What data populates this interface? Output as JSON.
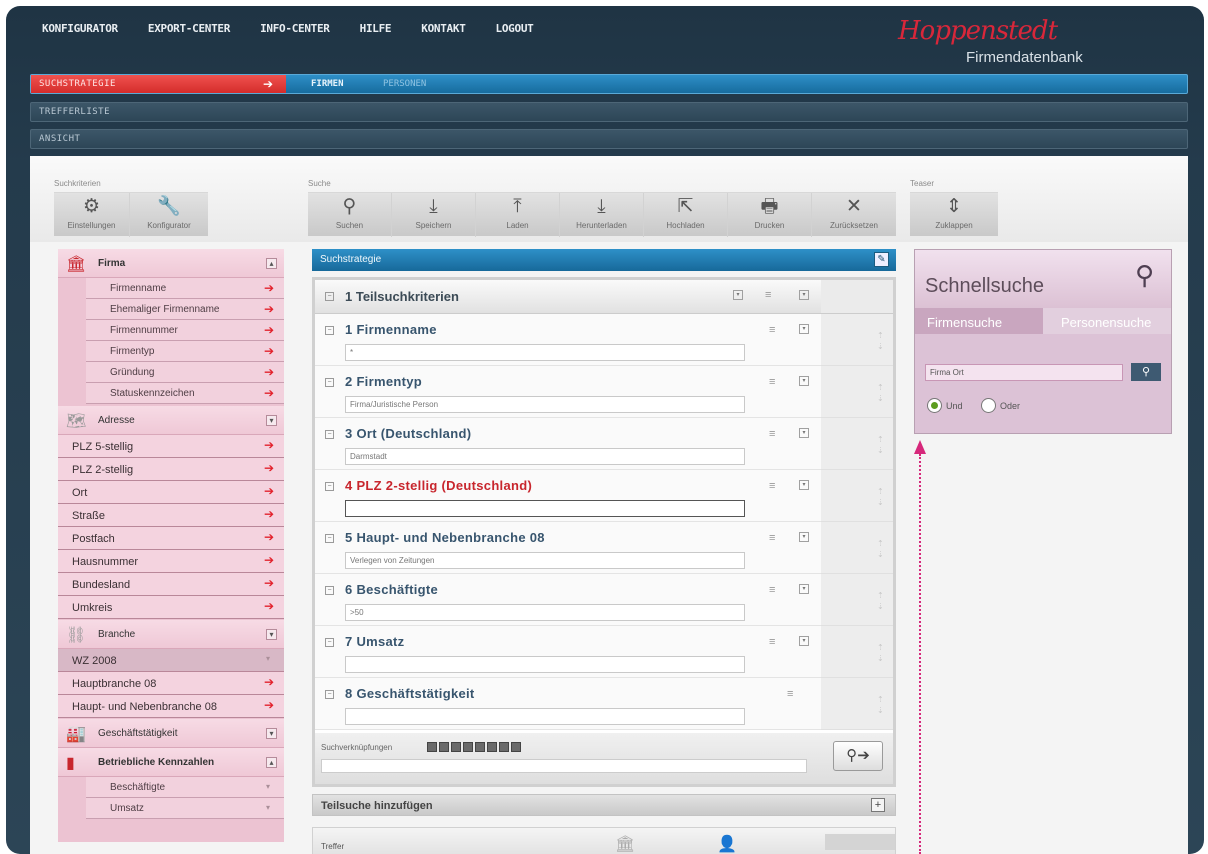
{
  "topnav": [
    "KONFIGURATOR",
    "EXPORT-CENTER",
    "INFO-CENTER",
    "HILFE",
    "KONTAKT",
    "LOGOUT"
  ],
  "logo": {
    "script": "Hoppenstedt",
    "sub": "Firmendatenbank"
  },
  "menubars": {
    "suchstrategie": "SUCHSTRATEGIE",
    "firmen": "FIRMEN",
    "personen": "PERSONEN",
    "trefferliste": "TREFFERLISTE",
    "ansicht": "ANSICHT"
  },
  "toolbar": {
    "groups": {
      "suchkriterien": "Suchkriterien",
      "suche": "Suche",
      "teaser": "Teaser"
    },
    "einstellungen": "Einstellungen",
    "konfigurator": "Konfigurator",
    "suchen": "Suchen",
    "speichern": "Speichern",
    "laden": "Laden",
    "herunterladen": "Herunterladen",
    "hochladen": "Hochladen",
    "drucken": "Drucken",
    "zuruecksetzen": "Zurücksetzen",
    "zuklappen": "Zuklappen"
  },
  "left": {
    "firma": "Firma",
    "firma_items": [
      "Firmenname",
      "Ehemaliger Firmenname",
      "Firmennummer",
      "Firmentyp",
      "Gründung",
      "Statuskennzeichen"
    ],
    "adresse": "Adresse",
    "adresse_items": [
      "PLZ 5-stellig",
      "PLZ 2-stellig",
      "Ort",
      "Straße",
      "Postfach",
      "Hausnummer",
      "Bundesland",
      "Umkreis"
    ],
    "branche": "Branche",
    "branche_items": [
      "WZ 2008",
      "Hauptbranche 08",
      "Haupt- und Nebenbranche 08"
    ],
    "geschaeft": "Geschäftstätigkeit",
    "kennzahlen": "Betriebliche Kennzahlen",
    "kennzahlen_items": [
      "Beschäftigte",
      "Umsatz"
    ]
  },
  "center": {
    "strategie": "Suchstrategie",
    "teilsuch": "1 Teilsuchkriterien",
    "criteria": [
      {
        "title": "1 Firmenname",
        "value": "*"
      },
      {
        "title": "2 Firmentyp",
        "value": "Firma/Juristische Person"
      },
      {
        "title": "3 Ort (Deutschland)",
        "value": "Darmstadt"
      },
      {
        "title": "4 PLZ 2-stellig (Deutschland)",
        "value": ""
      },
      {
        "title": "5 Haupt- und Nebenbranche 08",
        "value": "Verlegen von Zeitungen"
      },
      {
        "title": "6 Beschäftigte",
        "value": ">50"
      },
      {
        "title": "7 Umsatz",
        "value": ""
      },
      {
        "title": "8 Geschäftstätigkeit",
        "value": ""
      }
    ],
    "suchverkn": "Suchverknüpfungen",
    "teilsuche": "Teilsuche hinzufügen",
    "treffer": "Treffer"
  },
  "schnell": {
    "title": "Schnellsuche",
    "tab1": "Firmensuche",
    "tab2": "Personensuche",
    "input": "Firma Ort",
    "und": "Und",
    "oder": "Oder"
  },
  "colors": {
    "accent": "#d8273a",
    "blue": "#2e90c8",
    "pink": "#ecc3d2",
    "annot": "#d6287b"
  }
}
